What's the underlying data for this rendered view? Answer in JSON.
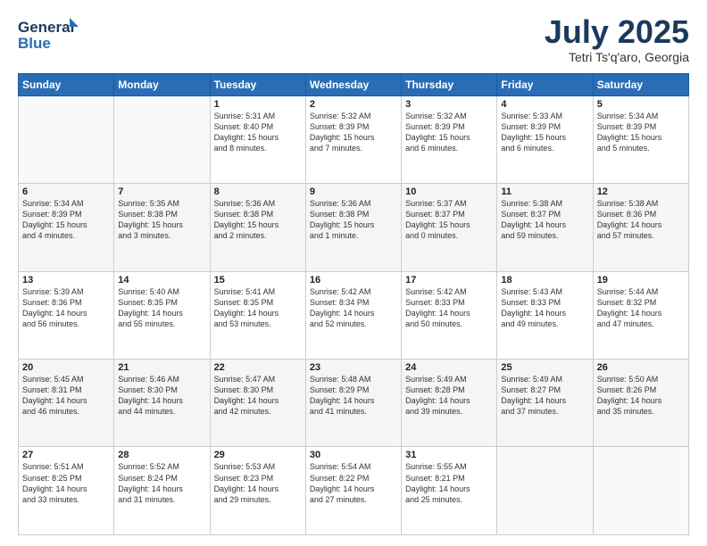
{
  "header": {
    "logo_line1": "General",
    "logo_line2": "Blue",
    "title": "July 2025",
    "subtitle": "Tetri Ts'q'aro, Georgia"
  },
  "weekdays": [
    "Sunday",
    "Monday",
    "Tuesday",
    "Wednesday",
    "Thursday",
    "Friday",
    "Saturday"
  ],
  "weeks": [
    [
      {
        "day": "",
        "info": ""
      },
      {
        "day": "",
        "info": ""
      },
      {
        "day": "1",
        "info": "Sunrise: 5:31 AM\nSunset: 8:40 PM\nDaylight: 15 hours\nand 8 minutes."
      },
      {
        "day": "2",
        "info": "Sunrise: 5:32 AM\nSunset: 8:39 PM\nDaylight: 15 hours\nand 7 minutes."
      },
      {
        "day": "3",
        "info": "Sunrise: 5:32 AM\nSunset: 8:39 PM\nDaylight: 15 hours\nand 6 minutes."
      },
      {
        "day": "4",
        "info": "Sunrise: 5:33 AM\nSunset: 8:39 PM\nDaylight: 15 hours\nand 6 minutes."
      },
      {
        "day": "5",
        "info": "Sunrise: 5:34 AM\nSunset: 8:39 PM\nDaylight: 15 hours\nand 5 minutes."
      }
    ],
    [
      {
        "day": "6",
        "info": "Sunrise: 5:34 AM\nSunset: 8:39 PM\nDaylight: 15 hours\nand 4 minutes."
      },
      {
        "day": "7",
        "info": "Sunrise: 5:35 AM\nSunset: 8:38 PM\nDaylight: 15 hours\nand 3 minutes."
      },
      {
        "day": "8",
        "info": "Sunrise: 5:36 AM\nSunset: 8:38 PM\nDaylight: 15 hours\nand 2 minutes."
      },
      {
        "day": "9",
        "info": "Sunrise: 5:36 AM\nSunset: 8:38 PM\nDaylight: 15 hours\nand 1 minute."
      },
      {
        "day": "10",
        "info": "Sunrise: 5:37 AM\nSunset: 8:37 PM\nDaylight: 15 hours\nand 0 minutes."
      },
      {
        "day": "11",
        "info": "Sunrise: 5:38 AM\nSunset: 8:37 PM\nDaylight: 14 hours\nand 59 minutes."
      },
      {
        "day": "12",
        "info": "Sunrise: 5:38 AM\nSunset: 8:36 PM\nDaylight: 14 hours\nand 57 minutes."
      }
    ],
    [
      {
        "day": "13",
        "info": "Sunrise: 5:39 AM\nSunset: 8:36 PM\nDaylight: 14 hours\nand 56 minutes."
      },
      {
        "day": "14",
        "info": "Sunrise: 5:40 AM\nSunset: 8:35 PM\nDaylight: 14 hours\nand 55 minutes."
      },
      {
        "day": "15",
        "info": "Sunrise: 5:41 AM\nSunset: 8:35 PM\nDaylight: 14 hours\nand 53 minutes."
      },
      {
        "day": "16",
        "info": "Sunrise: 5:42 AM\nSunset: 8:34 PM\nDaylight: 14 hours\nand 52 minutes."
      },
      {
        "day": "17",
        "info": "Sunrise: 5:42 AM\nSunset: 8:33 PM\nDaylight: 14 hours\nand 50 minutes."
      },
      {
        "day": "18",
        "info": "Sunrise: 5:43 AM\nSunset: 8:33 PM\nDaylight: 14 hours\nand 49 minutes."
      },
      {
        "day": "19",
        "info": "Sunrise: 5:44 AM\nSunset: 8:32 PM\nDaylight: 14 hours\nand 47 minutes."
      }
    ],
    [
      {
        "day": "20",
        "info": "Sunrise: 5:45 AM\nSunset: 8:31 PM\nDaylight: 14 hours\nand 46 minutes."
      },
      {
        "day": "21",
        "info": "Sunrise: 5:46 AM\nSunset: 8:30 PM\nDaylight: 14 hours\nand 44 minutes."
      },
      {
        "day": "22",
        "info": "Sunrise: 5:47 AM\nSunset: 8:30 PM\nDaylight: 14 hours\nand 42 minutes."
      },
      {
        "day": "23",
        "info": "Sunrise: 5:48 AM\nSunset: 8:29 PM\nDaylight: 14 hours\nand 41 minutes."
      },
      {
        "day": "24",
        "info": "Sunrise: 5:49 AM\nSunset: 8:28 PM\nDaylight: 14 hours\nand 39 minutes."
      },
      {
        "day": "25",
        "info": "Sunrise: 5:49 AM\nSunset: 8:27 PM\nDaylight: 14 hours\nand 37 minutes."
      },
      {
        "day": "26",
        "info": "Sunrise: 5:50 AM\nSunset: 8:26 PM\nDaylight: 14 hours\nand 35 minutes."
      }
    ],
    [
      {
        "day": "27",
        "info": "Sunrise: 5:51 AM\nSunset: 8:25 PM\nDaylight: 14 hours\nand 33 minutes."
      },
      {
        "day": "28",
        "info": "Sunrise: 5:52 AM\nSunset: 8:24 PM\nDaylight: 14 hours\nand 31 minutes."
      },
      {
        "day": "29",
        "info": "Sunrise: 5:53 AM\nSunset: 8:23 PM\nDaylight: 14 hours\nand 29 minutes."
      },
      {
        "day": "30",
        "info": "Sunrise: 5:54 AM\nSunset: 8:22 PM\nDaylight: 14 hours\nand 27 minutes."
      },
      {
        "day": "31",
        "info": "Sunrise: 5:55 AM\nSunset: 8:21 PM\nDaylight: 14 hours\nand 25 minutes."
      },
      {
        "day": "",
        "info": ""
      },
      {
        "day": "",
        "info": ""
      }
    ]
  ]
}
